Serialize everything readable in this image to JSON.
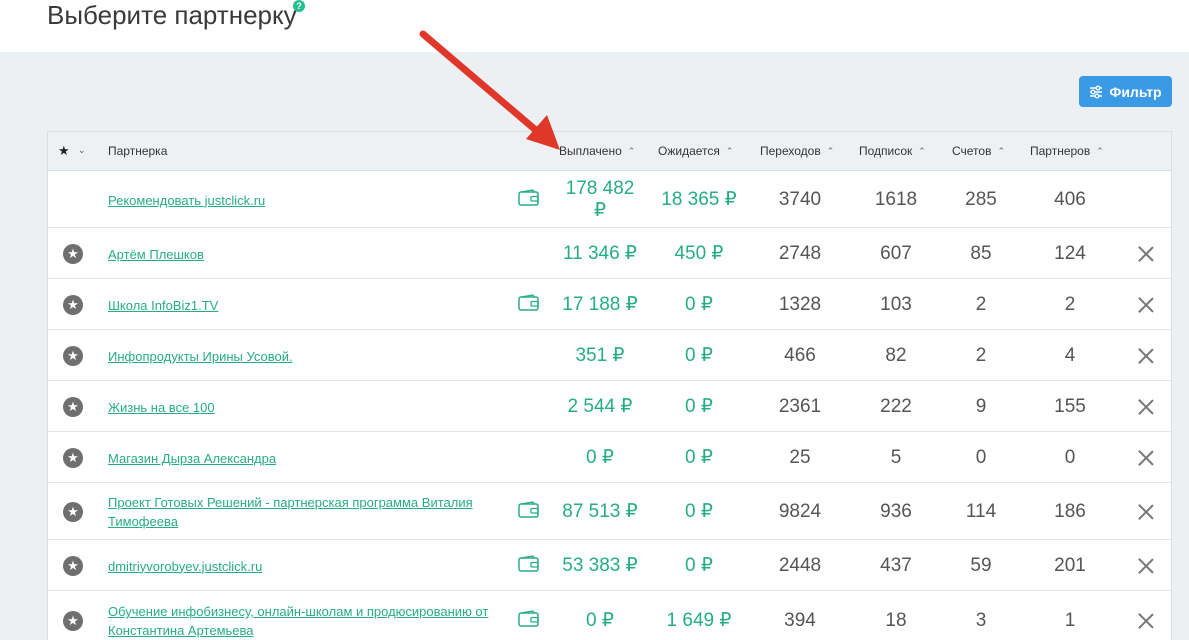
{
  "header": {
    "title": "Выберите партнерку",
    "help_badge": "?"
  },
  "filter": {
    "label": "Фильтр"
  },
  "table": {
    "columns": {
      "partner": "Партнерка",
      "paid": "Выплачено",
      "expected": "Ожидается",
      "clicks": "Переходов",
      "subscriptions": "Подписок",
      "invoices": "Счетов",
      "partners": "Партнеров"
    },
    "sort_caret": "⌃",
    "rows": [
      {
        "name": "Рекомендовать justclick.ru",
        "name2": "",
        "starred": false,
        "wallet": true,
        "paid": "178 482",
        "paid2": "₽",
        "expected": "18 365 ₽",
        "clicks": "3740",
        "subs": "1618",
        "invoices": "285",
        "partners": "406",
        "removable": false
      },
      {
        "name": "Артём Плешков",
        "name2": "",
        "starred": true,
        "wallet": false,
        "paid": "11 346 ₽",
        "paid2": "",
        "expected": "450 ₽",
        "clicks": "2748",
        "subs": "607",
        "invoices": "85",
        "partners": "124",
        "removable": true
      },
      {
        "name": "Школа InfoBiz1.TV",
        "name2": "",
        "starred": true,
        "wallet": true,
        "paid": "17 188 ₽",
        "paid2": "",
        "expected": "0 ₽",
        "clicks": "1328",
        "subs": "103",
        "invoices": "2",
        "partners": "2",
        "removable": true
      },
      {
        "name": "Инфопродукты Ирины Усовой.",
        "name2": "",
        "starred": true,
        "wallet": false,
        "paid": "351 ₽",
        "paid2": "",
        "expected": "0 ₽",
        "clicks": "466",
        "subs": "82",
        "invoices": "2",
        "partners": "4",
        "removable": true
      },
      {
        "name": "Жизнь на все 100",
        "name2": "",
        "starred": true,
        "wallet": false,
        "paid": "2 544 ₽",
        "paid2": "",
        "expected": "0 ₽",
        "clicks": "2361",
        "subs": "222",
        "invoices": "9",
        "partners": "155",
        "removable": true
      },
      {
        "name": "Магазин Дырза Александра",
        "name2": "",
        "starred": true,
        "wallet": false,
        "paid": "0 ₽",
        "paid2": "",
        "expected": "0 ₽",
        "clicks": "25",
        "subs": "5",
        "invoices": "0",
        "partners": "0",
        "removable": true
      },
      {
        "name": "Проект Готовых Решений - партнерская программа Виталия",
        "name2": "Тимофеева",
        "starred": true,
        "wallet": true,
        "paid": "87 513 ₽",
        "paid2": "",
        "expected": "0 ₽",
        "clicks": "9824",
        "subs": "936",
        "invoices": "114",
        "partners": "186",
        "removable": true
      },
      {
        "name": "dmitriyvorobyev.justclick.ru",
        "name2": "",
        "starred": true,
        "wallet": true,
        "paid": "53 383 ₽",
        "paid2": "",
        "expected": "0 ₽",
        "clicks": "2448",
        "subs": "437",
        "invoices": "59",
        "partners": "201",
        "removable": true
      },
      {
        "name": "Обучение инфобизнесу, онлайн-школам и продюсированию от",
        "name2": "Константина Артемьева",
        "starred": true,
        "wallet": true,
        "paid": "0 ₽",
        "paid2": "",
        "expected": "1 649 ₽",
        "clicks": "394",
        "subs": "18",
        "invoices": "3",
        "partners": "1",
        "removable": true
      }
    ]
  },
  "colors": {
    "accent_green": "#26ad83",
    "filter_blue": "#3a9ae6",
    "arrow_red": "#e0372b"
  }
}
